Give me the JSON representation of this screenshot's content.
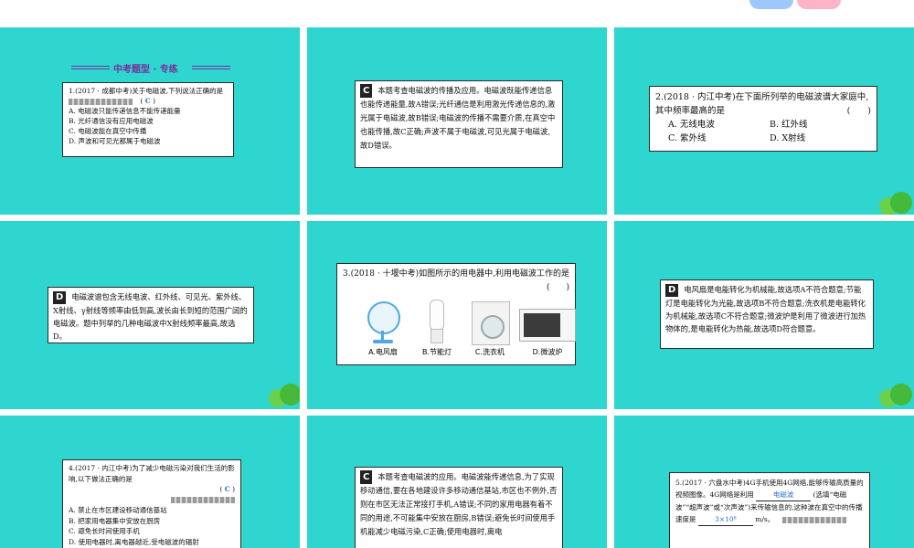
{
  "colors": {
    "slide_bg": "#2ed6cf",
    "card_bg": "#ffffff",
    "accent": "#7a2f9c",
    "blank_text": "#2a6bd8"
  },
  "s1": {
    "heading": "中考题型 · 专练",
    "q": "1.(2017 · 成都中考)关于电磁波,下列说法正确的是",
    "answer": "C",
    "options": [
      "A. 电磁波只能传递信息不能传递能量",
      "B. 光纤通信没有应用电磁波",
      "C. 电磁波能在真空中传播",
      "D. 声波和可见光都属于电磁波"
    ]
  },
  "s2": {
    "answer": "C",
    "text": "本题考查电磁波的传播及应用。电磁波既能传递信息也能传递能量,故A错误;光纤通信是利用激光传递信息的,激光属于电磁波,故B错误;电磁波的传播不需要介质,在真空中也能传播,故C正确;声波不属于电磁波,可见光属于电磁波,故D错误。"
  },
  "s3": {
    "q": "2.(2018 · 内江中考)在下面所列举的电磁波谱大家庭中,其中频率最高的是",
    "paren": "(　　)",
    "options": [
      "A. 无线电波",
      "B. 红外线",
      "C. 紫外线",
      "D. X射线"
    ]
  },
  "s4": {
    "answer": "D",
    "text": "电磁波谱包含无线电波、红外线、可见光、紫外线、X射线、γ射线等频率由低到高,波长由长到短的范围广阔的电磁波。题中列举的几种电磁波中X射线频率最高,故选D。"
  },
  "s5": {
    "q": "3.(2018 · 十堰中考)如图所示的用电器中,利用电磁波工作的是",
    "paren": "(　　)",
    "items": [
      "A.电风扇",
      "B.节能灯",
      "C.洗衣机",
      "D.微波炉"
    ]
  },
  "s6": {
    "answer": "D",
    "text": "电风扇是电能转化为机械能,故选项A不符合题意;节能灯是电能转化为光能,故选项B不符合题意;洗衣机是电能转化为机械能,故选项C不符合题意;微波炉是利用了微波进行加热物体的,是电能转化为热能,故选项D符合题意。"
  },
  "s7": {
    "q": "4.(2017 · 内江中考)为了减少电磁污染对我们生活的影响,以下做法正确的是",
    "answer": "C",
    "options": [
      "A. 禁止在市区建设移动通信基站",
      "B. 把家用电器集中安放在厨房",
      "C. 避免长时间使用手机",
      "D. 使用电器时,离电器越近,受电磁波的辐射"
    ]
  },
  "s8": {
    "answer": "C",
    "text": "本题考查电磁波的应用。电磁波能传递信息,为了实现移动通信,要在各地建设许多移动通信基站,市区也不例外,否则在市区无法正常接打手机,A错误;不同的家用电器有着不同的用途,不可能集中安放在厨房,B错误;避免长时间使用手机能减少电磁污染,C正确;使用电器时,离电"
  },
  "s9": {
    "q1": "5.(2017 · 六盘水中考)4G手机使用4G网络,能够传输高质量的视频图像。4G网络是利用",
    "blank1": "电磁波",
    "q2": "(选填“电磁波”“超声波”或“次声波”)来传输信息的,这种波在真空中的传播速度是",
    "blank2": "3×10⁸",
    "q3": "m/s。"
  }
}
